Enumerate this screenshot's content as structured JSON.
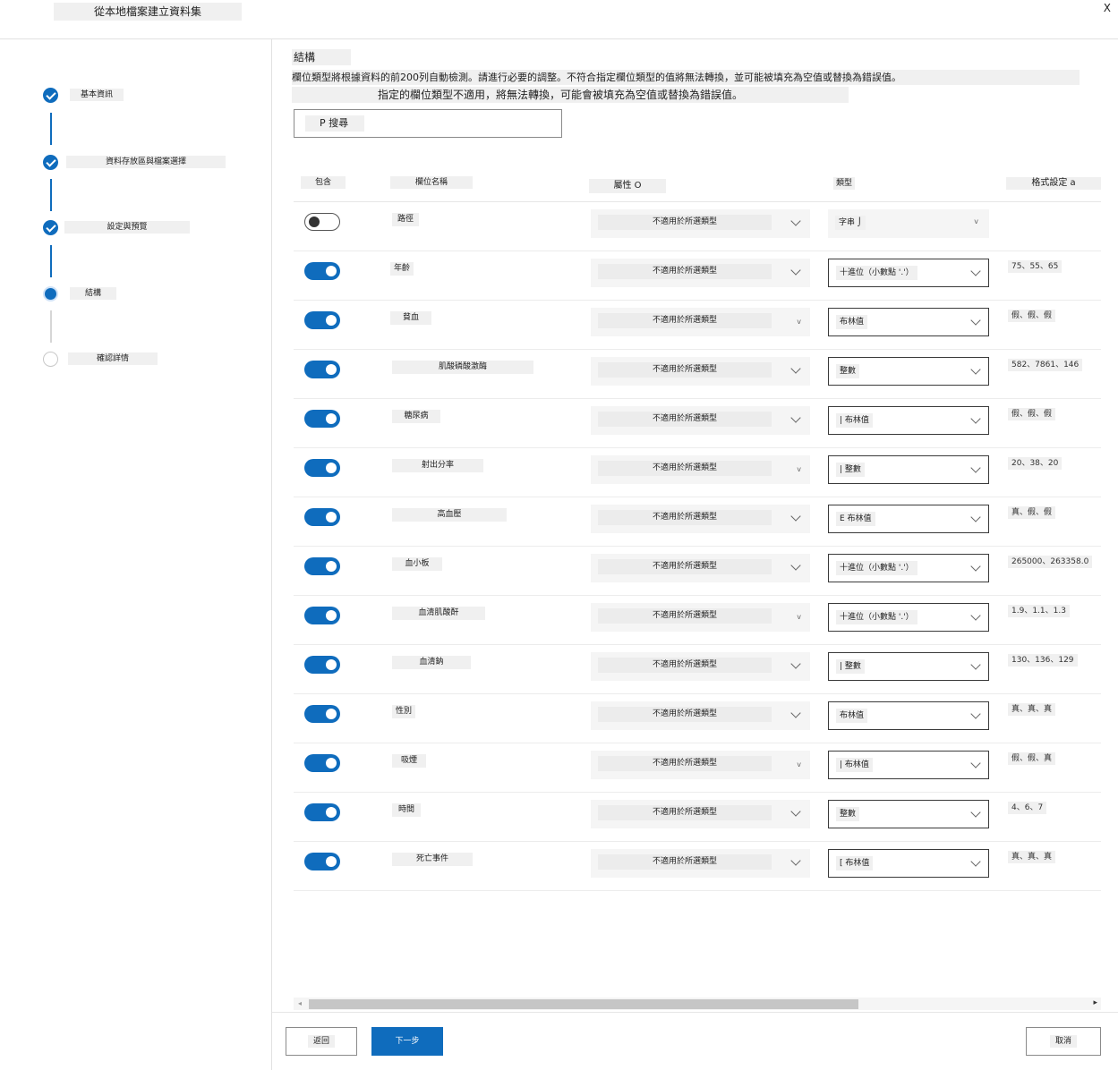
{
  "window": {
    "title": "從本地檔案建立資料集",
    "close_label": "X"
  },
  "steps": [
    {
      "label": "基本資訊",
      "status": "done"
    },
    {
      "label": "資料存放區與檔案選擇",
      "status": "done"
    },
    {
      "label": "設定與預覽",
      "status": "done"
    },
    {
      "label": "結構",
      "status": "current"
    },
    {
      "label": "確認詳情",
      "status": "todo"
    }
  ],
  "main": {
    "title": "結構",
    "description_1": "欄位類型將根據資料的前200列自動檢測。請進行必要的調整。不符合指定欄位類型的值將無法轉換，並可能被填充為空值或替換為錯誤值。",
    "description_2": "指定的欄位類型不適用，將無法轉換，可能會被填充為空值或替換為錯誤值。",
    "search_placeholder": "P 搜尋"
  },
  "table": {
    "headers": {
      "include": "包含",
      "column_name": "欄位名稱",
      "property": "屬性 O",
      "type": "類型",
      "format": "格式設定 a"
    },
    "rows": [
      {
        "included": false,
        "name": "路徑",
        "property": "不適用於所選類型",
        "type": "字串  ⌡",
        "format": "",
        "type_editable": false
      },
      {
        "included": true,
        "name": "年齡",
        "property": "不適用於所選類型",
        "type": "十進位（小數點 '.'）",
        "format": "75、55、65",
        "type_editable": true
      },
      {
        "included": true,
        "name": "貧血",
        "property": "不適用於所選類型",
        "type": "布林值",
        "format": "假、假、假",
        "type_editable": true
      },
      {
        "included": true,
        "name": "肌酸磷酸激酶",
        "property": "不適用於所選類型",
        "type": "整數",
        "format": "582、7861、146",
        "type_editable": true
      },
      {
        "included": true,
        "name": "糖尿病",
        "property": "不適用於所選類型",
        "type": "| 布林值",
        "format": "假、假、假",
        "type_editable": true
      },
      {
        "included": true,
        "name": "射出分率",
        "property": "不適用於所選類型",
        "type": "| 整數",
        "format": "20、38、20",
        "type_editable": true
      },
      {
        "included": true,
        "name": "高血壓",
        "property": "不適用於所選類型",
        "type": "E 布林值",
        "format": "真、假、假",
        "type_editable": true
      },
      {
        "included": true,
        "name": "血小板",
        "property": "不適用於所選類型",
        "type": "十進位（小數點 '.'）",
        "format": "265000、263358.0",
        "type_editable": true
      },
      {
        "included": true,
        "name": "血清肌酸酐",
        "property": "不適用於所選類型",
        "type": "十進位（小數點 '.'）",
        "format": "1.9、1.1、1.3",
        "type_editable": true
      },
      {
        "included": true,
        "name": "血清鈉",
        "property": "不適用於所選類型",
        "type": "| 整數",
        "format": "130、136、129",
        "type_editable": true
      },
      {
        "included": true,
        "name": "性別",
        "property": "不適用於所選類型",
        "type": "布林值",
        "format": "真、真、真",
        "type_editable": true
      },
      {
        "included": true,
        "name": "吸煙",
        "property": "不適用於所選類型",
        "type": "| 布林值",
        "format": "假、假、真",
        "type_editable": true
      },
      {
        "included": true,
        "name": "時間",
        "property": "不適用於所選類型",
        "type": "整數",
        "format": "4、6、7",
        "type_editable": true
      },
      {
        "included": true,
        "name": "死亡事件",
        "property": "不適用於所選類型",
        "type": "[ 布林值",
        "format": "真、真、真",
        "type_editable": true
      }
    ]
  },
  "footer": {
    "back_label": "返回",
    "next_label": "下一步",
    "cancel_label": "取消"
  },
  "colors": {
    "accent": "#0f6cbd",
    "panel_bg": "#f0f0f0",
    "border": "#e1e1e1"
  }
}
